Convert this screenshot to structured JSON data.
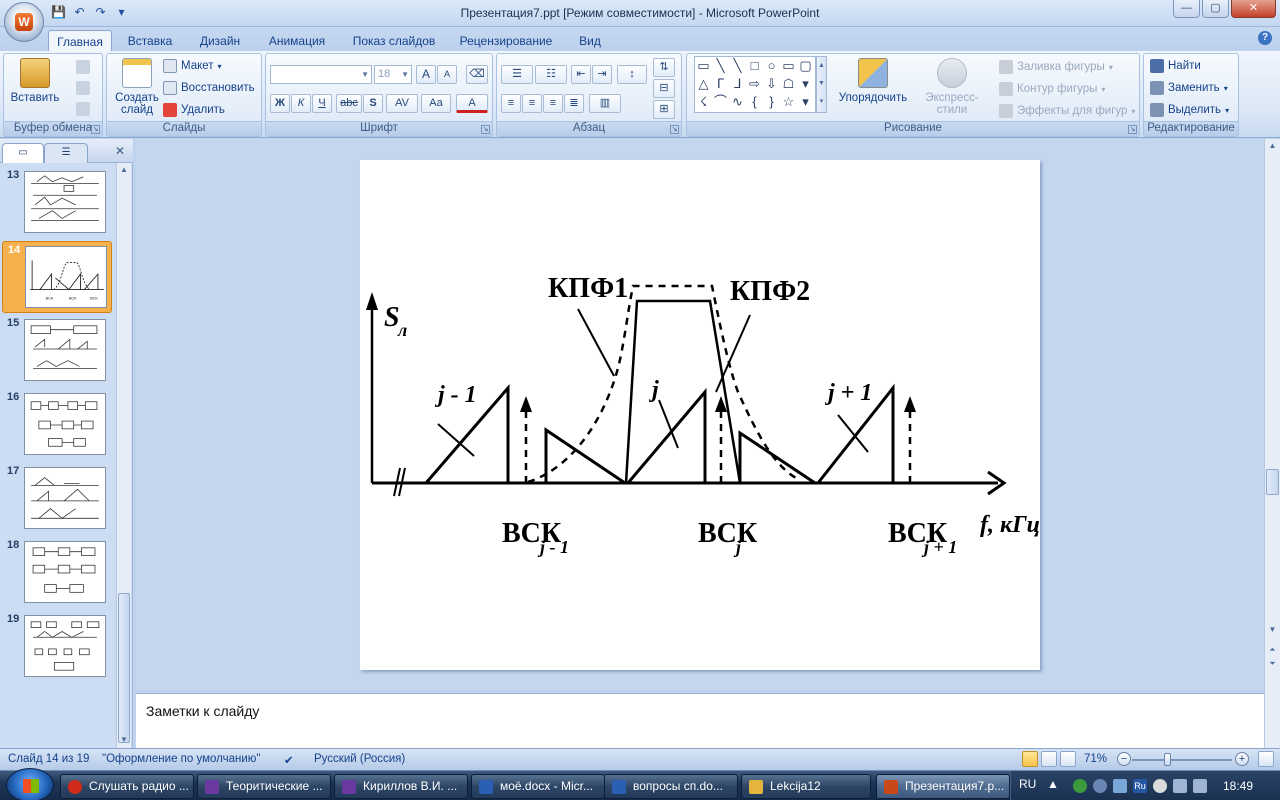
{
  "window": {
    "title": "Презентация7.ppt [Режим совместимости] - Microsoft PowerPoint",
    "office_button_letter": "W",
    "minimize": "—",
    "maximize": "▢",
    "close": "✕"
  },
  "qat": {
    "save": "💾",
    "undo": "↶",
    "redo": "↷",
    "customize": "▾"
  },
  "tabs": [
    {
      "label": "Главная"
    },
    {
      "label": "Вставка"
    },
    {
      "label": "Дизайн"
    },
    {
      "label": "Анимация"
    },
    {
      "label": "Показ слайдов"
    },
    {
      "label": "Рецензирование"
    },
    {
      "label": "Вид"
    }
  ],
  "help": "?",
  "ribbon": {
    "clipboard": {
      "label": "Буфер обмена",
      "paste": "Вставить"
    },
    "slides": {
      "label": "Слайды",
      "new_slide": "Создать слайд",
      "layout": "Макет",
      "reset": "Восстановить",
      "delete": "Удалить"
    },
    "font": {
      "label": "Шрифт",
      "font_name": "",
      "font_size": "18",
      "bold": "Ж",
      "italic": "К",
      "underline": "Ч",
      "strike": "abc",
      "shadow": "S",
      "spacing": "AV",
      "case": "Aa",
      "color": "A",
      "grow": "A",
      "shrink": "A"
    },
    "paragraph": {
      "label": "Абзац"
    },
    "drawing": {
      "label": "Рисование",
      "arrange": "Упорядочить",
      "quick_styles": "Экспресс-стили",
      "fill": "Заливка фигуры",
      "outline": "Контур фигуры",
      "effects": "Эффекты для фигур"
    },
    "editing": {
      "label": "Редактирование",
      "find": "Найти",
      "replace": "Заменить",
      "select": "Выделить"
    }
  },
  "shapes_gallery": [
    "▭",
    "╲",
    "╲",
    "□",
    "○",
    "▭",
    "▢",
    "△",
    "ᒥ",
    "ᒧ",
    "⇨",
    "⇩",
    "☖",
    "▾",
    "☇",
    "⌒",
    "∿",
    "{",
    "}",
    "☆",
    "▾"
  ],
  "slides_panel": {
    "close": "✕",
    "items": [
      {
        "num": "13",
        "selected": false
      },
      {
        "num": "14",
        "selected": true
      },
      {
        "num": "15",
        "selected": false
      },
      {
        "num": "16",
        "selected": false
      },
      {
        "num": "17",
        "selected": false
      },
      {
        "num": "18",
        "selected": false
      },
      {
        "num": "19",
        "selected": false
      }
    ]
  },
  "slide": {
    "y_axis_label": "S",
    "y_axis_sub": "л",
    "filter1": "КПФ1",
    "filter2": "КПФ2",
    "ch_left": "j - 1",
    "ch_mid": "j",
    "ch_right": "j + 1",
    "bsk_left": "ВСК",
    "bsk_left_sub": "j - 1",
    "bsk_mid": "ВСК",
    "bsk_mid_sub": "j",
    "bsk_right": "ВСК",
    "bsk_right_sub": "j + 1",
    "x_axis_label": "f, кГц"
  },
  "notes": {
    "placeholder": "Заметки к слайду"
  },
  "status": {
    "slide_info": "Слайд 14 из 19",
    "theme": "\"Оформление по умолчанию\"",
    "language": "Русский (Россия)",
    "zoom": "71%",
    "zoom_minus": "−",
    "zoom_plus": "+"
  },
  "taskbar": {
    "items": [
      {
        "label": "Слушать радио ...",
        "color": "#d12b1b"
      },
      {
        "label": "Теоритические ...",
        "color": "#6a3aa0"
      },
      {
        "label": "Кириллов В.И. ...",
        "color": "#6a3aa0"
      },
      {
        "label": "моё.docx - Micr...",
        "color": "#2b5fb4"
      },
      {
        "label": "вопросы сп.do...",
        "color": "#2b5fb4"
      },
      {
        "label": "Lekcija12",
        "color": "#e3b53c"
      },
      {
        "label": "Презентация7.p...",
        "color": "#c9481a"
      }
    ],
    "lang": "RU",
    "lang_icon": "Ru",
    "time": "18:49"
  }
}
